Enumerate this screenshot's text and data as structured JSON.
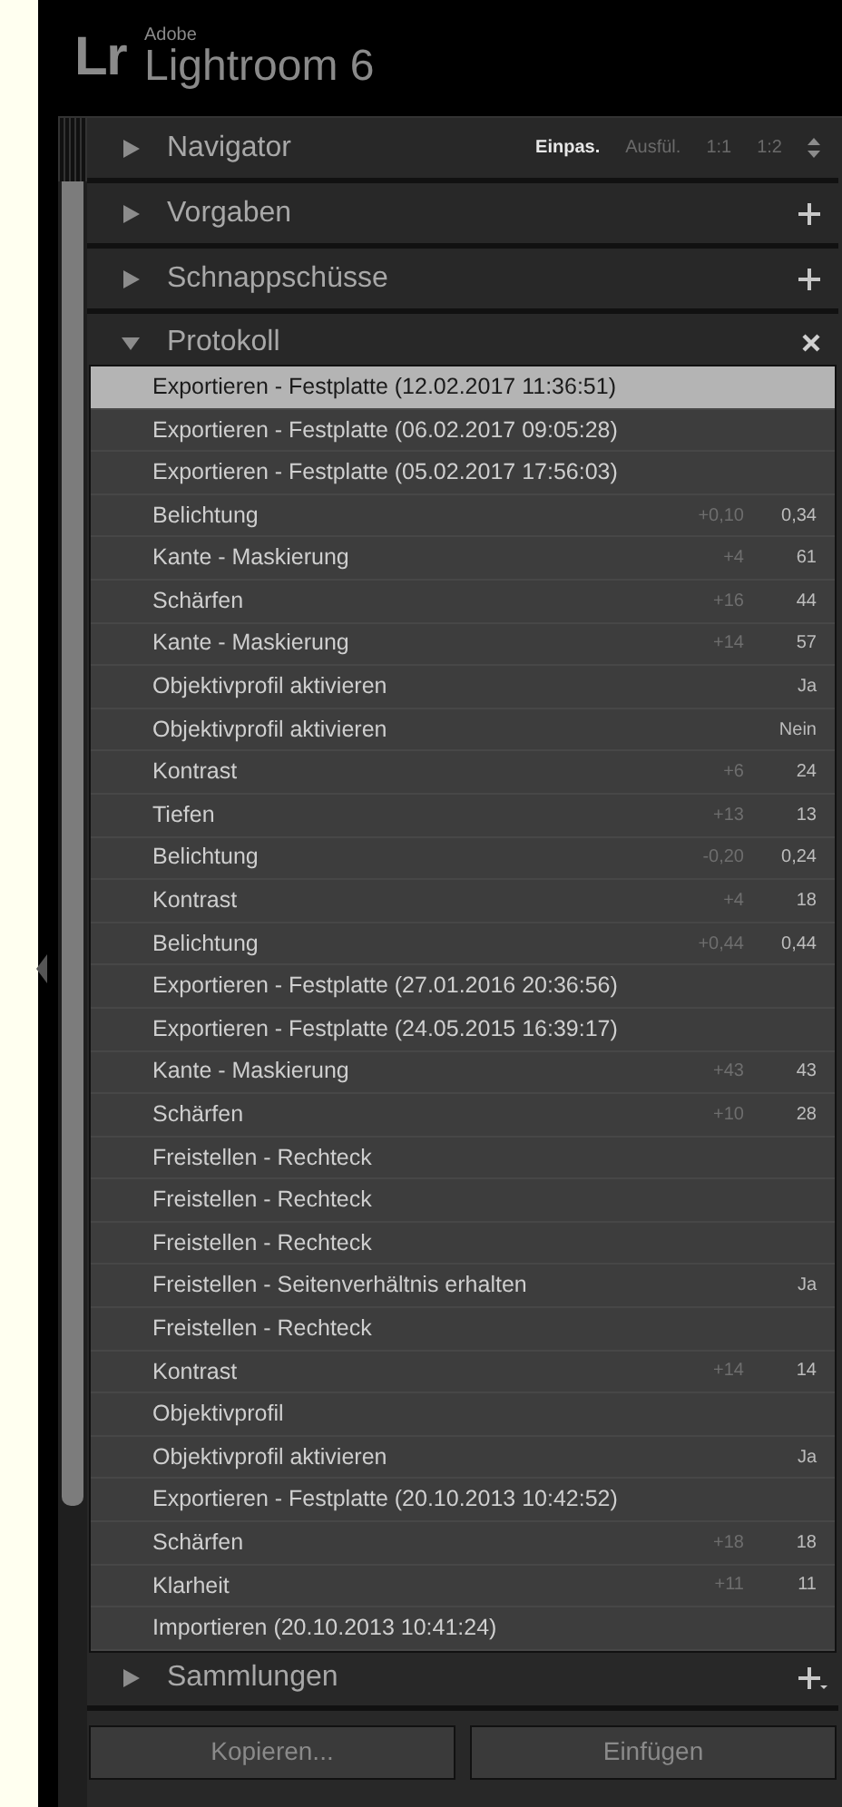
{
  "app": {
    "vendor": "Adobe",
    "title": "Lightroom 6",
    "logo": "Lr"
  },
  "sections": [
    {
      "title": "Navigator",
      "expanded": false,
      "kind": "zoom",
      "zoom_options": [
        {
          "label": "Einpas.",
          "selected": true
        },
        {
          "label": "Ausfül.",
          "selected": false
        },
        {
          "label": "1:1",
          "selected": false
        },
        {
          "label": "1:2",
          "selected": false
        }
      ]
    },
    {
      "title": "Vorgaben",
      "expanded": false,
      "kind": "add"
    },
    {
      "title": "Schnappschüsse",
      "expanded": false,
      "kind": "add"
    },
    {
      "title": "Protokoll",
      "expanded": true,
      "kind": "clear"
    }
  ],
  "history": [
    {
      "name": "Exportieren - Festplatte (12.02.2017 11:36:51)",
      "selected": true
    },
    {
      "name": "Exportieren - Festplatte (06.02.2017 09:05:28)",
      "selected": false
    },
    {
      "name": "Exportieren - Festplatte (05.02.2017 17:56:03)",
      "selected": false
    },
    {
      "name": "Belichtung",
      "step": "+0,10",
      "value": "0,34",
      "selected": false
    },
    {
      "name": "Kante - Maskierung",
      "step": "+4",
      "value": "61",
      "selected": false
    },
    {
      "name": "Schärfen",
      "step": "+16",
      "value": "44",
      "selected": false
    },
    {
      "name": "Kante - Maskierung",
      "step": "+14",
      "value": "57",
      "selected": false
    },
    {
      "name": "Objektivprofil aktivieren",
      "value": "Ja",
      "selected": false
    },
    {
      "name": "Objektivprofil aktivieren",
      "value": "Nein",
      "selected": false
    },
    {
      "name": "Kontrast",
      "step": "+6",
      "value": "24",
      "selected": false
    },
    {
      "name": "Tiefen",
      "step": "+13",
      "value": "13",
      "selected": false
    },
    {
      "name": "Belichtung",
      "step": "-0,20",
      "value": "0,24",
      "selected": false
    },
    {
      "name": "Kontrast",
      "step": "+4",
      "value": "18",
      "selected": false
    },
    {
      "name": "Belichtung",
      "step": "+0,44",
      "value": "0,44",
      "selected": false
    },
    {
      "name": "Exportieren - Festplatte (27.01.2016 20:36:56)",
      "selected": false
    },
    {
      "name": "Exportieren - Festplatte (24.05.2015 16:39:17)",
      "selected": false
    },
    {
      "name": "Kante - Maskierung",
      "step": "+43",
      "value": "43",
      "selected": false
    },
    {
      "name": "Schärfen",
      "step": "+10",
      "value": "28",
      "selected": false
    },
    {
      "name": "Freistellen - Rechteck",
      "selected": false
    },
    {
      "name": "Freistellen - Rechteck",
      "selected": false
    },
    {
      "name": "Freistellen - Rechteck",
      "selected": false
    },
    {
      "name": "Freistellen - Seitenverhältnis erhalten",
      "value": "Ja",
      "selected": false
    },
    {
      "name": "Freistellen - Rechteck",
      "selected": false
    },
    {
      "name": "Kontrast",
      "step": "+14",
      "value": "14",
      "selected": false
    },
    {
      "name": "Objektivprofil",
      "selected": false
    },
    {
      "name": "Objektivprofil aktivieren",
      "value": "Ja",
      "selected": false
    },
    {
      "name": "Exportieren - Festplatte (20.10.2013 10:42:52)",
      "selected": false
    },
    {
      "name": "Schärfen",
      "step": "+18",
      "value": "18",
      "selected": false
    },
    {
      "name": "Klarheit",
      "step": "+11",
      "value": "11",
      "selected": false
    },
    {
      "name": "Importieren (20.10.2013 10:41:24)",
      "selected": false
    }
  ],
  "bottom_section": {
    "title": "Sammlungen",
    "expanded": false
  },
  "buttons": [
    "Kopieren...",
    "Einfügen"
  ]
}
